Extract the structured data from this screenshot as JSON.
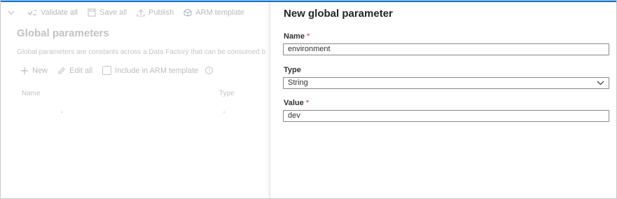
{
  "toolbar": {
    "validate_all": "Validate all",
    "save_all": "Save all",
    "publish": "Publish",
    "arm_template": "ARM template"
  },
  "global_parameters": {
    "title": "Global parameters",
    "description": "Global parameters are constants across a Data Factory that can be consumed b",
    "actions": {
      "new": "New",
      "edit_all": "Edit all",
      "include_arm": "Include in ARM template"
    },
    "columns": [
      "Name",
      "Type"
    ]
  },
  "panel": {
    "title": "New global parameter",
    "name_label": "Name",
    "type_label": "Type",
    "value_label": "Value",
    "required_mark": "*",
    "name_value": "environment",
    "type_value": "String",
    "value_value": "dev"
  },
  "colors": {
    "accent": "#0078d4",
    "required": "#c4314b"
  }
}
